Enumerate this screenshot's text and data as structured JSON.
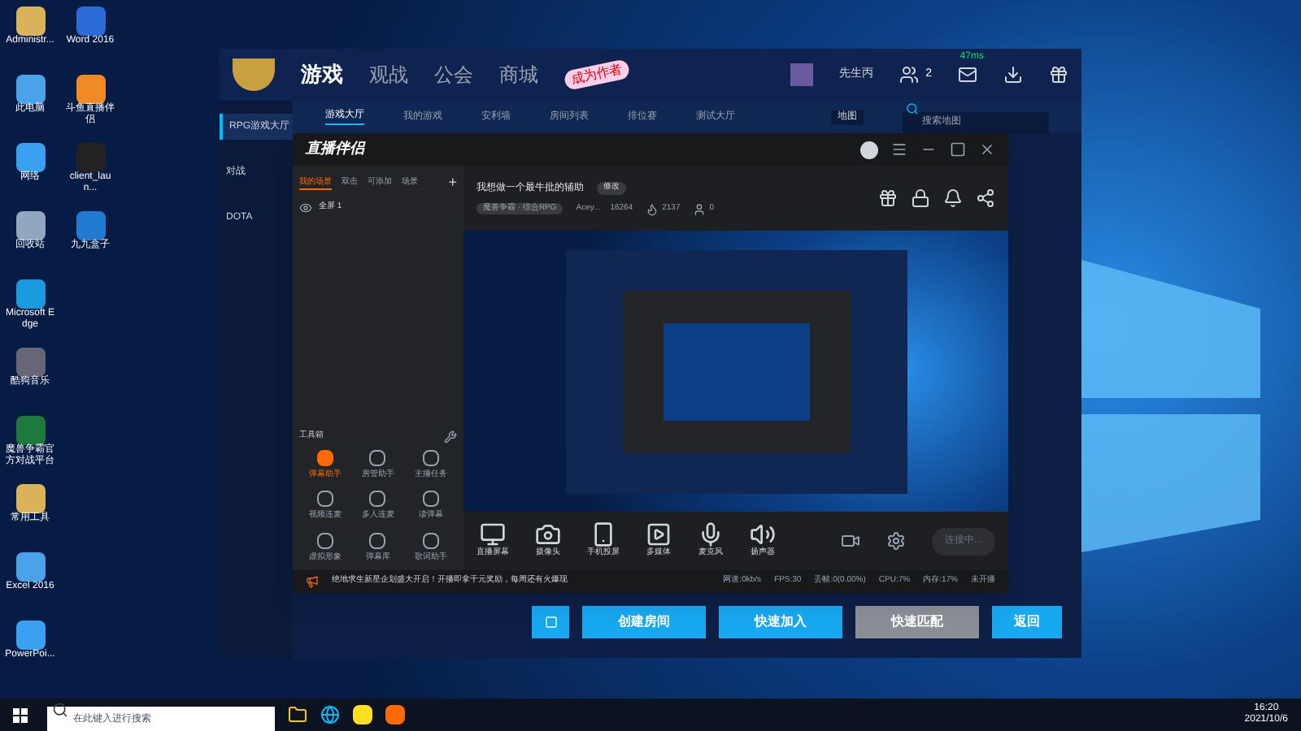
{
  "desktop_icon_columns": [
    [
      {
        "label": "Administr..."
      },
      {
        "label": "此电脑"
      },
      {
        "label": "网络"
      },
      {
        "label": "回收站"
      },
      {
        "label": "Microsoft Edge"
      },
      {
        "label": "酷狗音乐"
      },
      {
        "label": "魔兽争霸官方对战平台"
      },
      {
        "label": "常用工具"
      },
      {
        "label": "Excel 2016"
      },
      {
        "label": "PowerPoi..."
      }
    ],
    [
      {
        "label": "Word 2016"
      },
      {
        "label": "斗鱼直播伴侣"
      },
      {
        "label": "client_laun..."
      },
      {
        "label": "九九盒子"
      }
    ]
  ],
  "game_window": {
    "nav": [
      {
        "label": "游戏",
        "selected": true
      },
      {
        "label": "观战",
        "selected": false
      },
      {
        "label": "公会",
        "selected": false
      },
      {
        "label": "商城",
        "selected": false
      }
    ],
    "author_badge": "成为作者",
    "ping": "47ms",
    "user": "先生丙",
    "friends_count": "2",
    "subnav": [
      {
        "label": "游戏大厅",
        "selected": true
      },
      {
        "label": "我的游戏",
        "selected": false
      },
      {
        "label": "安利墙",
        "selected": false
      },
      {
        "label": "房间列表",
        "selected": false
      },
      {
        "label": "排位赛",
        "selected": false
      },
      {
        "label": "测试大厅",
        "selected": false
      }
    ],
    "map_filter": "地图",
    "search": {
      "placeholder": "搜索地图"
    },
    "sidebar": [
      {
        "label": "RPG游戏大厅",
        "selected": true
      },
      {
        "label": "对战",
        "selected": false
      },
      {
        "label": "DOTA",
        "selected": false
      }
    ],
    "buttons": [
      {
        "label": "创建房间",
        "kind": "primary"
      },
      {
        "label": "快速加入",
        "kind": "primary"
      },
      {
        "label": "快速匹配",
        "kind": "secondary"
      },
      {
        "label": "返回",
        "kind": "primary"
      }
    ]
  },
  "stream_window": {
    "title": "直播伴侣",
    "scene_tabs": [
      {
        "label": "我的场景",
        "selected": true
      },
      {
        "label": "双击",
        "selected": false
      },
      {
        "label": "可添加",
        "selected": false
      },
      {
        "label": "场景",
        "selected": false
      }
    ],
    "add": "+",
    "scenes": [
      {
        "label": "全屏 1"
      }
    ],
    "toolbox_title": "工具箱",
    "tools": [
      {
        "label": "弹幕助手",
        "active": true
      },
      {
        "label": "房管助手",
        "active": false
      },
      {
        "label": "主播任务",
        "active": false
      },
      {
        "label": "视频连麦",
        "active": false
      },
      {
        "label": "多人连麦",
        "active": false
      },
      {
        "label": "读弹幕",
        "active": false
      },
      {
        "label": "虚拟形象",
        "active": false
      },
      {
        "label": "弹幕库",
        "active": false
      },
      {
        "label": "歌词助手",
        "active": false
      }
    ],
    "room_title": "我想做一个最牛批的辅助",
    "edit": "修改",
    "category": "魔兽争霸 · 综合RPG",
    "stats": [
      {
        "kind": "user",
        "text": "Acey...",
        "extra": "16264"
      },
      {
        "kind": "fire",
        "text": "2137"
      },
      {
        "kind": "person",
        "text": "0"
      }
    ],
    "sources": [
      {
        "label": "直播屏幕",
        "kind": "screen"
      },
      {
        "label": "摄像头",
        "kind": "camera"
      },
      {
        "label": "手机投屏",
        "kind": "phone"
      },
      {
        "label": "多媒体",
        "kind": "media"
      },
      {
        "label": "麦克风",
        "kind": "mic"
      },
      {
        "label": "扬声器",
        "kind": "speaker"
      }
    ],
    "connect": "连接中...",
    "notice": "绝地求生新星企划盛大开启！开播即拿千元奖励，每周还有火爆现",
    "status": [
      "网速:0kb/s",
      "FPS:30",
      "丢帧:0(0.00%)",
      "CPU:7%",
      "内存:17%",
      "未开播"
    ]
  },
  "taskbar": {
    "search": {
      "placeholder": "在此键入进行搜索"
    },
    "time": "16:20",
    "date": "2021/10/6"
  }
}
